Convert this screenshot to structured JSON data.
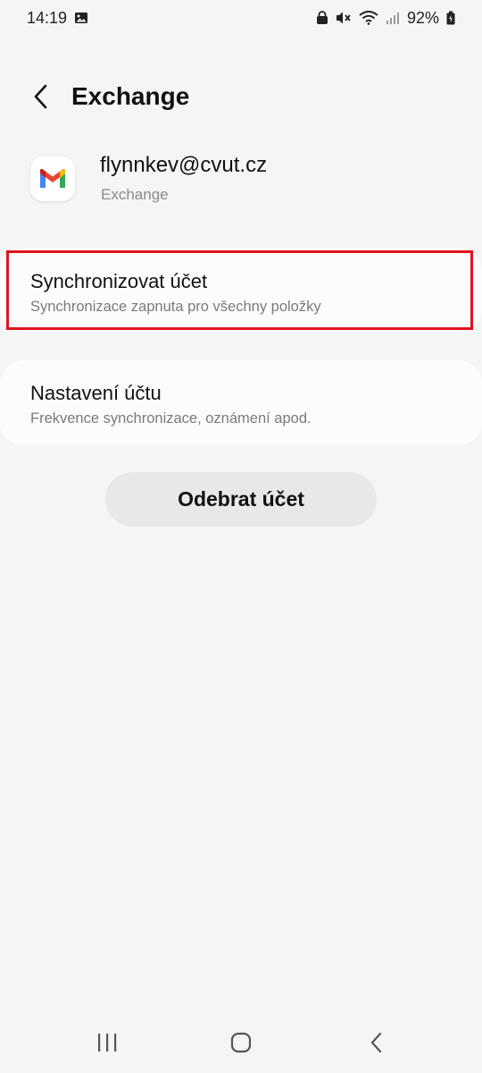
{
  "status_bar": {
    "time": "14:19",
    "battery_percent": "92%",
    "icons": [
      "image-icon",
      "lock-icon",
      "mute-icon",
      "wifi-icon",
      "signal-icon",
      "battery-icon"
    ]
  },
  "header": {
    "title": "Exchange",
    "back_icon": "chevron-left-icon"
  },
  "account": {
    "email": "flynnkev@cvut.cz",
    "type": "Exchange",
    "app_icon": "gmail-icon"
  },
  "items": [
    {
      "title": "Synchronizovat účet",
      "subtitle": "Synchronizace zapnuta pro všechny položky",
      "highlighted": true
    },
    {
      "title": "Nastavení účtu",
      "subtitle": "Frekvence synchronizace, oznámení apod.",
      "highlighted": false
    }
  ],
  "remove_button": {
    "label": "Odebrat účet"
  },
  "nav_bar": {
    "icons": [
      "recents-icon",
      "home-icon",
      "back-icon"
    ]
  },
  "colors": {
    "background": "#f5f5f5",
    "highlight": "#e0141f",
    "button": "#e8e8e8"
  }
}
